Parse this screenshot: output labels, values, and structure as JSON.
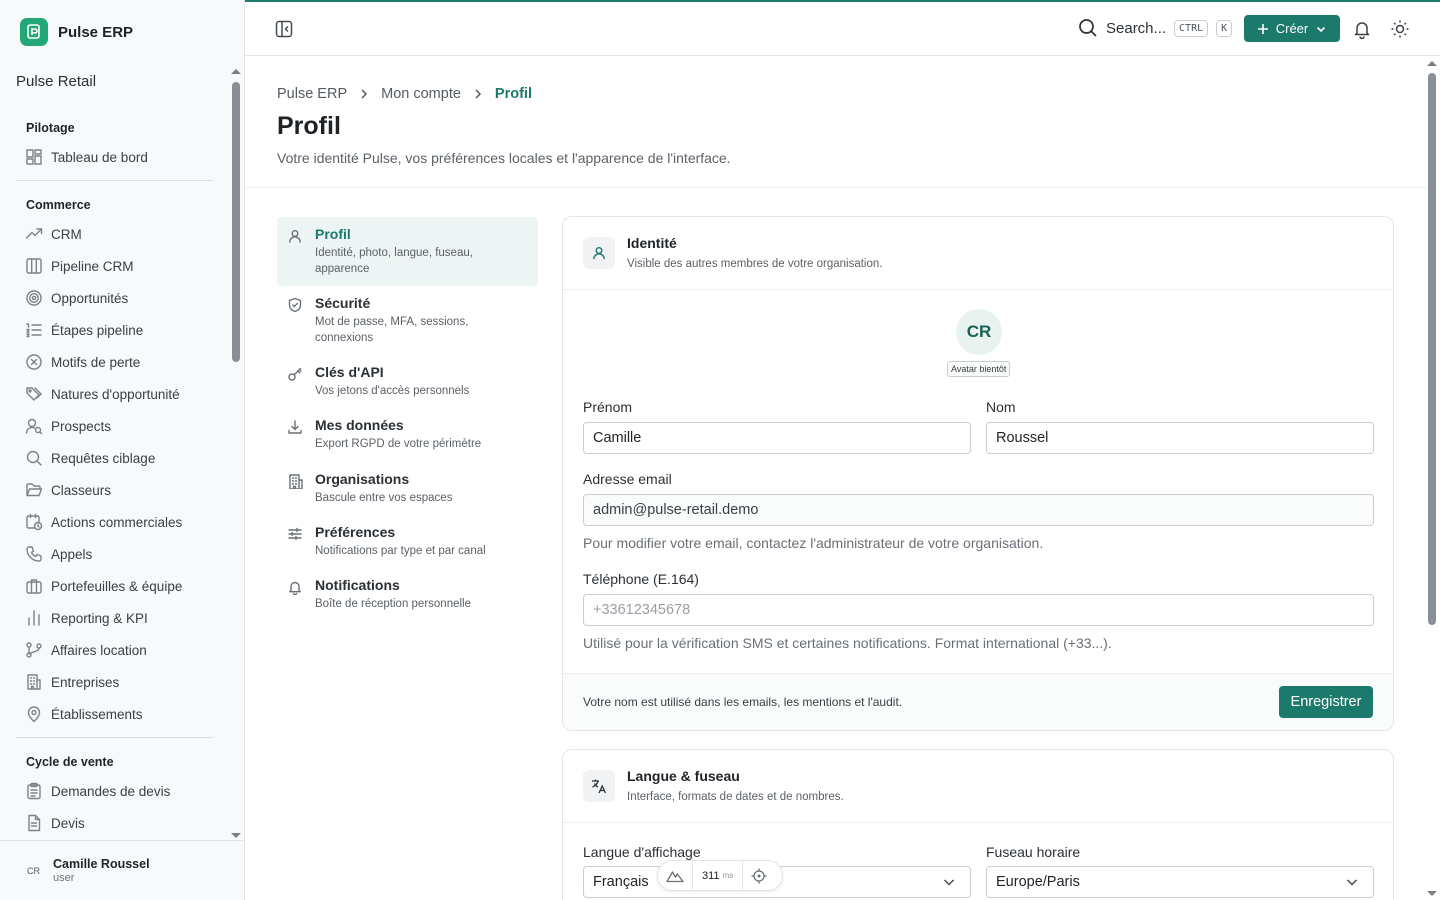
{
  "app": {
    "brand": "Pulse ERP",
    "workspace": "Pulse Retail"
  },
  "sidebar": {
    "groups": [
      {
        "title": "Pilotage",
        "items": [
          {
            "label": "Tableau de bord",
            "icon": "dashboard-icon"
          }
        ]
      },
      {
        "title": "Commerce",
        "items": [
          {
            "label": "CRM",
            "icon": "trending-up-icon"
          },
          {
            "label": "Pipeline CRM",
            "icon": "columns-icon"
          },
          {
            "label": "Opportunités",
            "icon": "target-icon"
          },
          {
            "label": "Étapes pipeline",
            "icon": "list-ordered-icon"
          },
          {
            "label": "Motifs de perte",
            "icon": "x-circle-icon"
          },
          {
            "label": "Natures d'opportunité",
            "icon": "tags-icon"
          },
          {
            "label": "Prospects",
            "icon": "user-search-icon"
          },
          {
            "label": "Requêtes ciblage",
            "icon": "search-icon"
          },
          {
            "label": "Classeurs",
            "icon": "folder-open-icon"
          },
          {
            "label": "Actions commerciales",
            "icon": "calendar-clock-icon"
          },
          {
            "label": "Appels",
            "icon": "phone-icon"
          },
          {
            "label": "Portefeuilles & équipe",
            "icon": "briefcase-icon"
          },
          {
            "label": "Reporting & KPI",
            "icon": "bar-chart-icon"
          },
          {
            "label": "Affaires location",
            "icon": "git-branch-icon"
          },
          {
            "label": "Entreprises",
            "icon": "building-icon"
          },
          {
            "label": "Établissements",
            "icon": "map-pin-icon"
          }
        ]
      },
      {
        "title": "Cycle de vente",
        "items": [
          {
            "label": "Demandes de devis",
            "icon": "clipboard-list-icon"
          },
          {
            "label": "Devis",
            "icon": "file-text-icon"
          }
        ]
      }
    ],
    "user": {
      "initials": "CR",
      "name": "Camille Roussel",
      "role": "user"
    }
  },
  "header": {
    "search_label": "Search...",
    "kbd_ctrl": "CTRL",
    "kbd_k": "K",
    "create_label": "Créer"
  },
  "breadcrumb": [
    "Pulse ERP",
    "Mon compte",
    "Profil"
  ],
  "page": {
    "title": "Profil",
    "subtitle": "Votre identité Pulse, vos préférences locales et l'apparence de l'interface."
  },
  "settings_nav": [
    {
      "title": "Profil",
      "desc": "Identité, photo, langue, fuseau, apparence",
      "icon": "user-icon",
      "active": true
    },
    {
      "title": "Sécurité",
      "desc": "Mot de passe, MFA, sessions, connexions",
      "icon": "shield-icon"
    },
    {
      "title": "Clés d'API",
      "desc": "Vos jetons d'accès personnels",
      "icon": "key-icon"
    },
    {
      "title": "Mes données",
      "desc": "Export RGPD de votre périmètre",
      "icon": "download-icon"
    },
    {
      "title": "Organisations",
      "desc": "Bascule entre vos espaces",
      "icon": "building-icon"
    },
    {
      "title": "Préférences",
      "desc": "Notifications par type et par canal",
      "icon": "sliders-icon"
    },
    {
      "title": "Notifications",
      "desc": "Boîte de réception personnelle",
      "icon": "bell-icon"
    }
  ],
  "identity": {
    "title": "Identité",
    "subtitle": "Visible des autres membres de votre organisation.",
    "avatar_initials": "CR",
    "avatar_badge": "Avatar bientôt",
    "first_name_label": "Prénom",
    "first_name": "Camille",
    "last_name_label": "Nom",
    "last_name": "Roussel",
    "email_label": "Adresse email",
    "email": "admin@pulse-retail.demo",
    "email_help": "Pour modifier votre email, contactez l'administrateur de votre organisation.",
    "phone_label": "Téléphone (E.164)",
    "phone_placeholder": "+33612345678",
    "phone_help": "Utilisé pour la vérification SMS et certaines notifications. Format international (+33...).",
    "footer_note": "Votre nom est utilisé dans les emails, les mentions et l'audit.",
    "save_label": "Enregistrer"
  },
  "locale": {
    "title": "Langue & fuseau",
    "subtitle": "Interface, formats de dates et de nombres.",
    "language_label": "Langue d'affichage",
    "language": "Français",
    "timezone_label": "Fuseau horaire",
    "timezone": "Europe/Paris"
  },
  "devbar": {
    "ms": "311",
    "unit": "ms"
  },
  "colors": {
    "accent": "#1c7a6c",
    "brand_logo": "#22a877"
  }
}
